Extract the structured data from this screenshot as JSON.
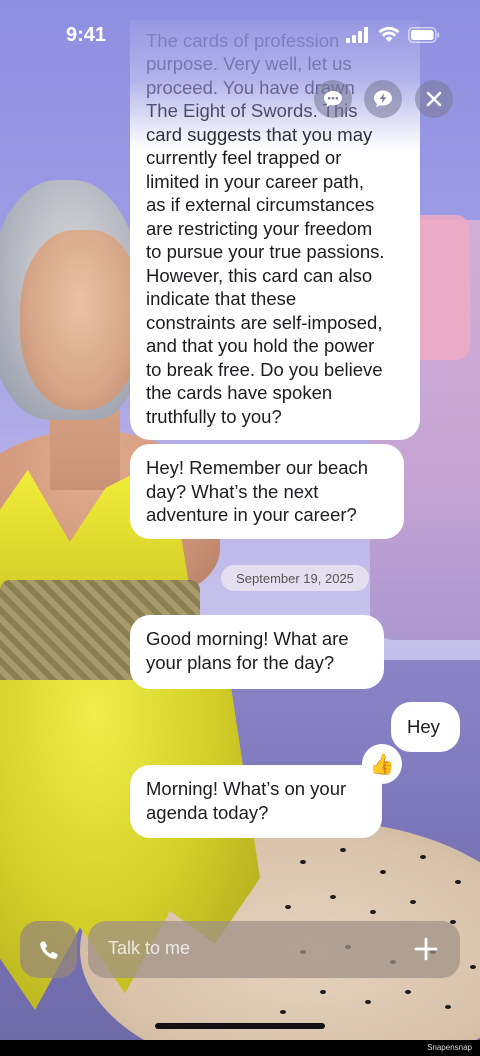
{
  "status_bar": {
    "time": "9:41"
  },
  "top_buttons": [
    "chat-bubble-icon",
    "lightning-icon",
    "close-icon"
  ],
  "messages": [
    {
      "sender": "assistant",
      "text": "The cards of profession … purpose. Very well, let us proceed. You have … The Eight of Swords. This card suggests that you may currently feel trapped or limited in your career path, as if external circumstances are restricting your freedom to pursue your true passions. However, this card can also indicate that these constraints are self-imposed, and that you hold the power to break free. Do you believe the cards have spoken truthfully to you?",
      "lines": [
        "The cards of profession",
        "purpose. Very well, let us",
        "proceed. You have drawn",
        "The Eight of Swords. This",
        "card suggests that you may",
        "currently feel trapped or",
        "limited in your career path,",
        "as if external circumstances",
        "are restricting your freedom",
        "to pursue your true passions.",
        "However, this card can also",
        "indicate that these",
        "constraints are self-imposed,",
        "and that you hold the power",
        "to break free. Do you believe",
        "the cards have spoken",
        "truthfully to you?"
      ]
    },
    {
      "sender": "assistant",
      "text": "Hey! Remember our beach day? What’s the next adventure in your career?"
    },
    {
      "sender": "assistant",
      "text": "Good morning! What are your plans for the day?"
    },
    {
      "sender": "user",
      "text": "Hey"
    },
    {
      "sender": "assistant",
      "text": "Morning! What’s on your agenda today?"
    }
  ],
  "date_divider": "September 19, 2025",
  "reaction": "👍",
  "composer": {
    "placeholder": "Talk to me",
    "call_icon": "phone-icon",
    "add_icon": "plus-icon"
  },
  "footer_credit": "Snapensnap"
}
